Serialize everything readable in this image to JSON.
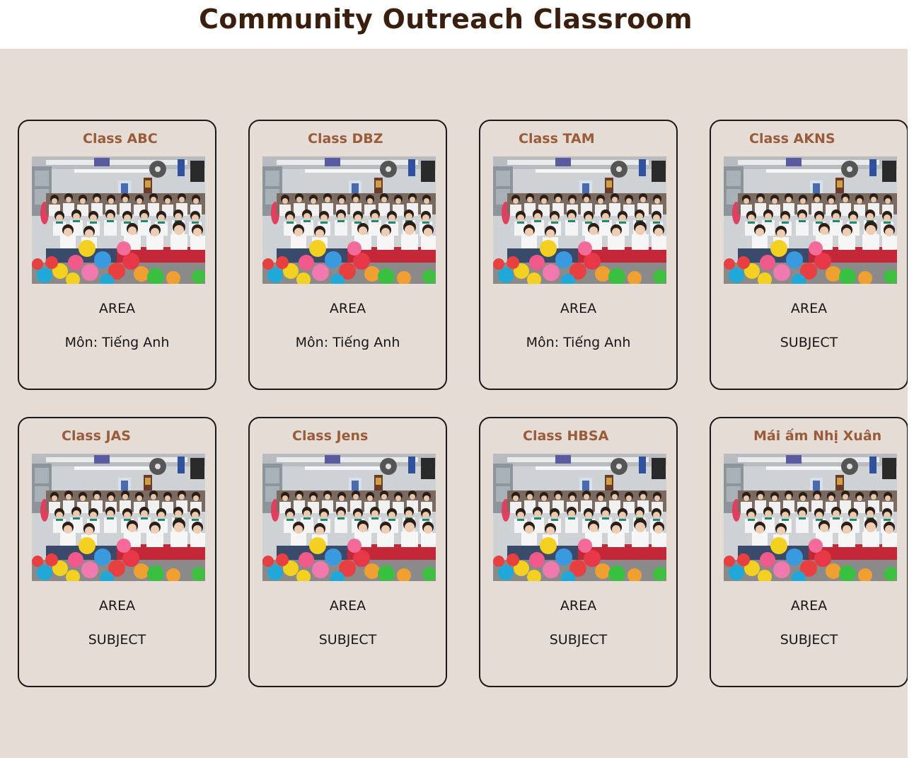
{
  "page": {
    "title": "Community Outreach Classroom"
  },
  "colors": {
    "background": "#e6dcd6",
    "title": "#3a1e0e",
    "card_title": "#9a5b38",
    "card_border": "#1a1a1a"
  },
  "classes": [
    {
      "title": "Class ABC",
      "area": "AREA",
      "subject": "Môn: Tiếng Anh"
    },
    {
      "title": "Class DBZ",
      "area": "AREA",
      "subject": "Môn: Tiếng Anh"
    },
    {
      "title": "Class TAM",
      "area": "AREA",
      "subject": "Môn: Tiếng Anh"
    },
    {
      "title": "Class AKNS",
      "area": "AREA",
      "subject": "SUBJECT"
    },
    {
      "title": "Class JAS",
      "area": "AREA",
      "subject": "SUBJECT"
    },
    {
      "title": "Class Jens",
      "area": "AREA",
      "subject": "SUBJECT"
    },
    {
      "title": "Class HBSA",
      "area": "AREA",
      "subject": "SUBJECT"
    },
    {
      "title": "Mái ấm Nhị Xuân",
      "area": "AREA",
      "subject": "SUBJECT"
    }
  ]
}
